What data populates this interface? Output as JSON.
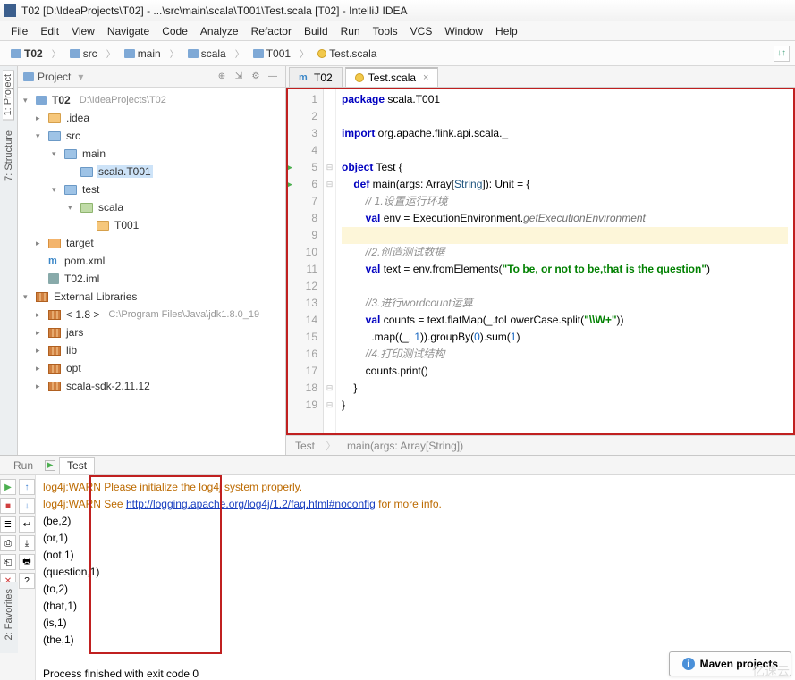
{
  "title": "T02 [D:\\IdeaProjects\\T02] - ...\\src\\main\\scala\\T001\\Test.scala [T02] - IntelliJ IDEA",
  "menus": [
    "File",
    "Edit",
    "View",
    "Navigate",
    "Code",
    "Analyze",
    "Refactor",
    "Build",
    "Run",
    "Tools",
    "VCS",
    "Window",
    "Help"
  ],
  "breadcrumbs": [
    "T02",
    "src",
    "main",
    "scala",
    "T001",
    "Test.scala"
  ],
  "side_tabs": {
    "project": "1: Project",
    "structure": "7: Structure",
    "favorites": "2: Favorites"
  },
  "project_panel": {
    "title": "Project",
    "root": {
      "name": "T02",
      "path": "D:\\IdeaProjects\\T02"
    },
    "idea": ".idea",
    "src": "src",
    "main": "main",
    "pkg": "scala.T001",
    "test": "test",
    "test_scala": "scala",
    "test_t001": "T001",
    "target": "target",
    "pom": "pom.xml",
    "iml": "T02.iml",
    "ext": "External Libraries",
    "jdk_prefix": "< 1.8 >",
    "jdk_path": "C:\\Program Files\\Java\\jdk1.8.0_19",
    "jars": "jars",
    "lib": "lib",
    "opt": "opt",
    "scala_sdk": "scala-sdk-2.11.12"
  },
  "editor": {
    "tab1": "T02",
    "tab2": "Test.scala",
    "status_context": "Test",
    "status_method": "main(args: Array[String])",
    "code": {
      "l1a": "package",
      "l1b": " scala.T001",
      "l3a": "import",
      "l3b": " org.apache.flink.api.scala._",
      "l5a": "object",
      "l5b": " Test {",
      "l6a": "    def",
      "l6b": " main(args: Array[",
      "l6c": "String",
      "l6d": "]): Unit = {",
      "l7": "        // 1.设置运行环境",
      "l8a": "        val",
      "l8b": " env = ExecutionEnvironment.",
      "l8c": "getExecutionEnvironment",
      "l10": "        //2.创造测试数据",
      "l11a": "        val",
      "l11b": " text = env.fromElements(",
      "l11c": "\"To be, or not to be,that is the question\"",
      "l11d": ")",
      "l13a": "        //3.进行",
      "l13b": "wordcount",
      "l13c": "运算",
      "l14a": "        val",
      "l14b": " counts = text.flatMap(_.toLowerCase.split(",
      "l14c": "\"\\\\W+\"",
      "l14d": "))",
      "l15a": "          .map((_, ",
      "l15b": "1",
      "l15c": ")).groupBy(",
      "l15d": "0",
      "l15e": ").sum(",
      "l15f": "1",
      "l15g": ")",
      "l16": "        //4.打印测试结构",
      "l17": "        counts.print()",
      "l18": "    }",
      "l19": "}"
    }
  },
  "run_panel": {
    "tab_run": "Run",
    "tab_test": "Test",
    "lines": {
      "w1a": "log4j:WARN Please initialize the log4j system properly.",
      "w2a": "log4j:WARN See ",
      "w2link": "http://logging.apache.org/log4j/1.2/faq.html#noconfig",
      "w2b": " for more info.",
      "r1": "(be,2)",
      "r2": "(or,1)",
      "r3": "(not,1)",
      "r4": "(question,1)",
      "r5": "(to,2)",
      "r6": "(that,1)",
      "r7": "(is,1)",
      "r8": "(the,1)",
      "exit": "Process finished with exit code 0"
    }
  },
  "maven_popup": "Maven projects",
  "watermark": "亿速云"
}
